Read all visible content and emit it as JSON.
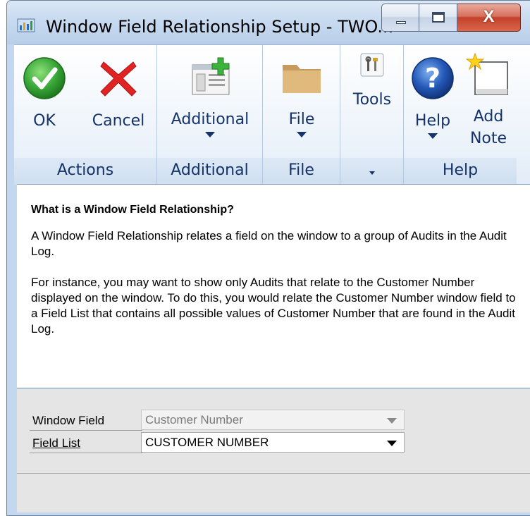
{
  "window": {
    "title": "Window Field Relationship Setup  -  TWO..."
  },
  "ribbon": {
    "groups": {
      "actions": {
        "label": "Actions",
        "ok_label": "OK",
        "cancel_label": "Cancel"
      },
      "additional": {
        "label": "Additional",
        "button_label": "Additional"
      },
      "file": {
        "label": "File",
        "button_label": "File"
      },
      "tools": {
        "button_label": "Tools"
      },
      "help": {
        "label": "Help",
        "help_label": "Help",
        "add_note_line1": "Add",
        "add_note_line2": "Note"
      }
    }
  },
  "help_text": {
    "heading": "What is a Window Field Relationship?",
    "paragraph1": "A Window Field Relationship relates a field on the window to a group of Audits in the Audit Log.",
    "paragraph2": "For instance, you may want to show only Audits that relate to the Customer Number displayed on the window.  To do this, you would relate the Customer Number window field to a Field List that contains all possible values of Customer Number that are found in the Audit Log."
  },
  "form": {
    "window_field": {
      "label": "Window Field",
      "value": "Customer Number"
    },
    "field_list": {
      "label": "Field List",
      "value": "CUSTOMER NUMBER"
    }
  },
  "colors": {
    "ribbon_text": "#15336b",
    "ok_green": "#3aa83a",
    "cancel_red": "#e02424",
    "help_blue": "#2458b8",
    "close_red": "#c4412a"
  }
}
